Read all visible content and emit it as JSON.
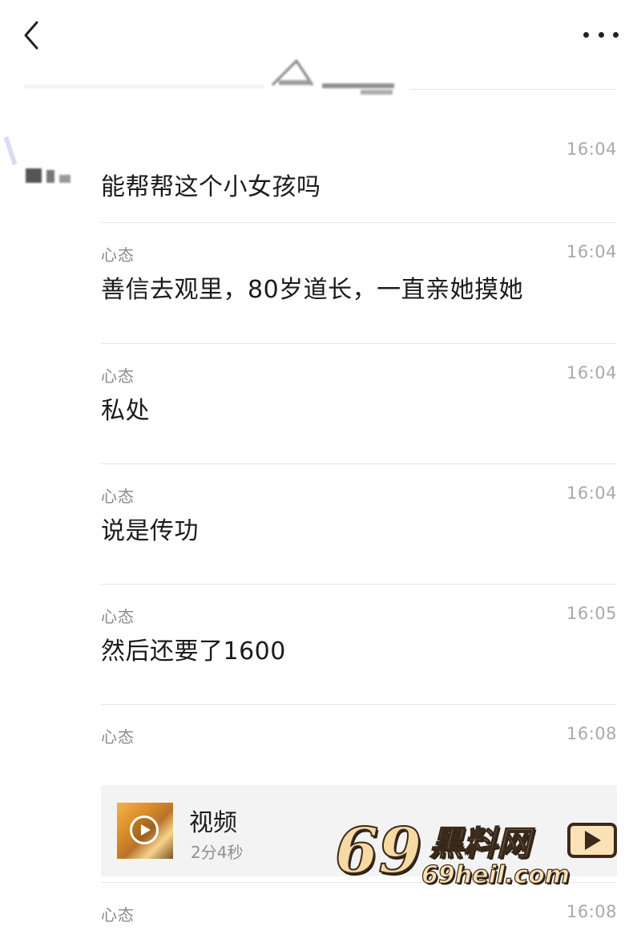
{
  "header": {
    "back_icon": "chevron-left-icon",
    "more_icon": "more-horizontal-icon"
  },
  "feed": [
    {
      "label": "",
      "time": "16:04",
      "text": "能帮帮这个小女孩吗"
    },
    {
      "label": "心态",
      "time": "16:04",
      "text": "善信去观里，80岁道长，一直亲她摸她"
    },
    {
      "label": "心态",
      "time": "16:04",
      "text": "私处"
    },
    {
      "label": "心态",
      "time": "16:04",
      "text": "说是传功"
    },
    {
      "label": "心态",
      "time": "16:05",
      "text": "然后还要了1600"
    },
    {
      "label": "心态",
      "time": "16:08",
      "video": {
        "title": "视频",
        "duration": "2分4秒",
        "icon": "video-play-icon"
      }
    },
    {
      "label": "心态",
      "time": "16:08",
      "text": ""
    }
  ],
  "watermark": {
    "number": "69",
    "name": "黑料网",
    "url": "69heil.com",
    "icon": "play-box-icon",
    "color_fill": "#fbe2b6",
    "color_stroke": "#3a2a1c"
  }
}
